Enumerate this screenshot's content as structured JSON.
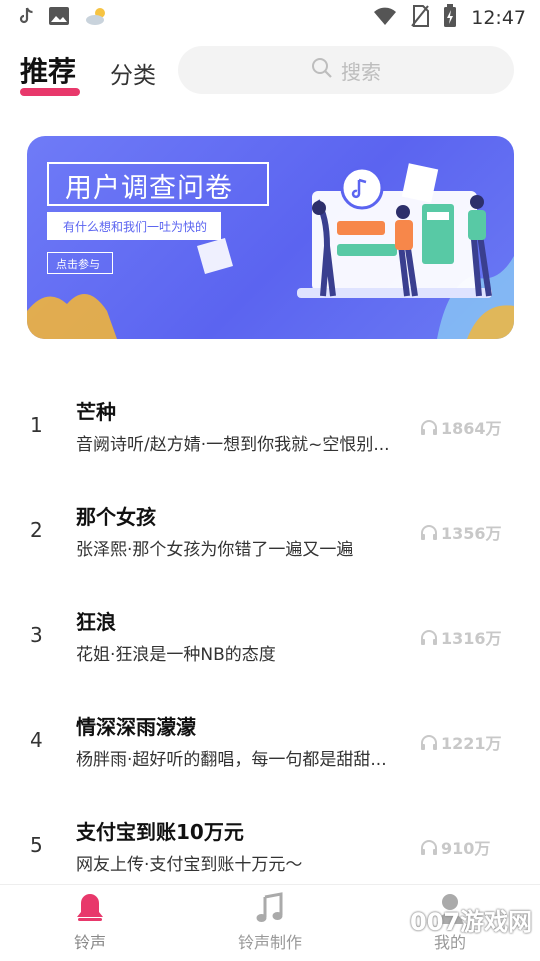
{
  "status_bar": {
    "time": "12:47",
    "icons": [
      "tiktok-icon",
      "gallery-icon",
      "weather-icon",
      "wifi-icon",
      "no-sim-icon",
      "battery-charging-icon"
    ]
  },
  "header": {
    "tab_recommend": "推荐",
    "tab_category": "分类",
    "search_placeholder": "搜索"
  },
  "banner": {
    "title": "用户调查问卷",
    "subtitle": "有什么想和我们一吐为快的",
    "button": "点击参与"
  },
  "songs": [
    {
      "rank": "1",
      "title": "芒种",
      "desc": "音阙诗听/赵方婧·一想到你我就~空恨别...",
      "plays": "1864万"
    },
    {
      "rank": "2",
      "title": "那个女孩",
      "desc": "张泽熙·那个女孩为你错了一遍又一遍",
      "plays": "1356万"
    },
    {
      "rank": "3",
      "title": "狂浪",
      "desc": "花姐·狂浪是一种NB的态度",
      "plays": "1316万"
    },
    {
      "rank": "4",
      "title": "情深深雨濛濛",
      "desc": "杨胖雨·超好听的翻唱，每一句都是甜甜...",
      "plays": "1221万"
    },
    {
      "rank": "5",
      "title": "支付宝到账10万元",
      "desc": "网友上传·支付宝到账十万元～",
      "plays": "910万"
    }
  ],
  "bottom_nav": {
    "items": [
      {
        "label": "铃声",
        "active": true
      },
      {
        "label": "铃声制作",
        "active": false
      },
      {
        "label": "我的",
        "active": false
      }
    ]
  },
  "colors": {
    "accent": "#e8386b",
    "banner": "#5b64f0"
  },
  "watermark": "007游戏网"
}
